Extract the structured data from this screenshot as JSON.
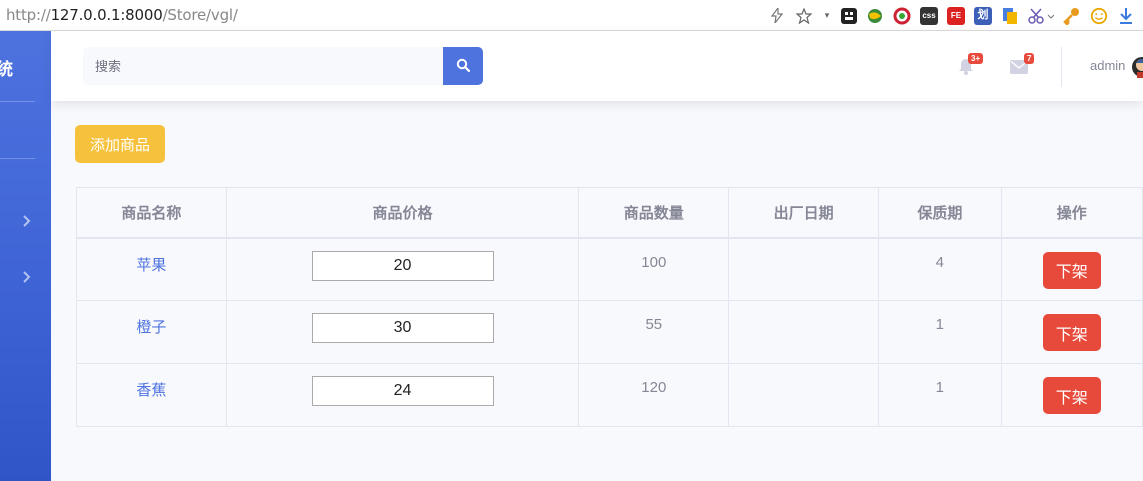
{
  "browser": {
    "url_prefix": "http://",
    "url_host": "127.0.0.1:8000",
    "url_path": "/Store/vgl/",
    "icons": [
      "lightning-icon",
      "star-icon",
      "dropdown-icon",
      "extension-icon",
      "globe-icon",
      "circle-icon",
      "css-icon",
      "fe-icon",
      "hua-icon",
      "translate-icon",
      "scissors-icon",
      "key-icon",
      "emoji-icon",
      "download-icon"
    ],
    "css_label": "css",
    "fe_label": "FE",
    "hua_label": "划"
  },
  "sidebar": {
    "brand_fragment": "统"
  },
  "topbar": {
    "search_placeholder": "搜索",
    "alerts_badge": "3+",
    "messages_badge": "7",
    "user_name": "admin"
  },
  "content": {
    "add_button_label": "添加商品",
    "table": {
      "headers": [
        "商品名称",
        "商品价格",
        "商品数量",
        "出厂日期",
        "保质期",
        "操作"
      ],
      "rows": [
        {
          "name": "苹果",
          "price": "20",
          "quantity": "100",
          "date": "",
          "shelf_life": "4",
          "action": "下架"
        },
        {
          "name": "橙子",
          "price": "30",
          "quantity": "55",
          "date": "",
          "shelf_life": "1",
          "action": "下架"
        },
        {
          "name": "香蕉",
          "price": "24",
          "quantity": "120",
          "date": "",
          "shelf_life": "1",
          "action": "下架"
        }
      ]
    }
  },
  "colors": {
    "primary": "#4e73df",
    "warning": "#f6c23e",
    "danger": "#e74a3b",
    "text_muted": "#858796"
  }
}
